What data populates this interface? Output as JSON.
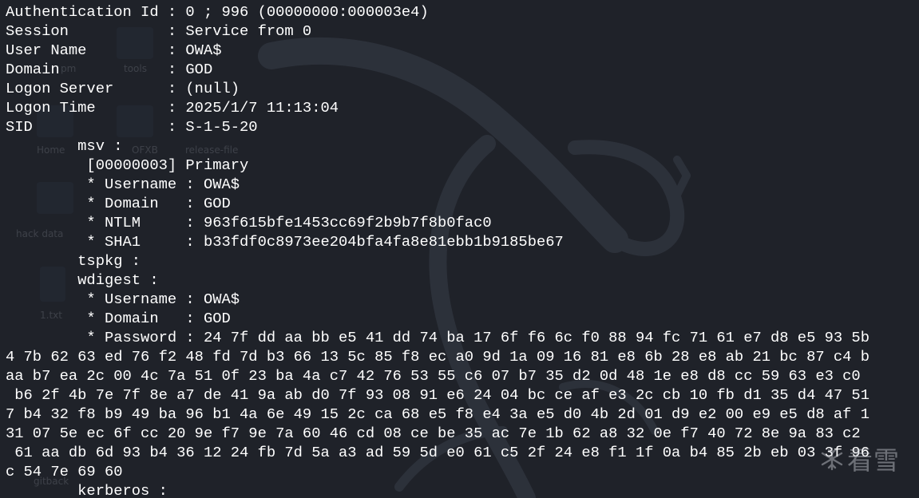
{
  "terminal": {
    "lines": [
      "Authentication Id : 0 ; 996 (00000000:000003e4)",
      "Session           : Service from 0",
      "User Name         : OWA$",
      "Domain            : GOD",
      "Logon Server      : (null)",
      "Logon Time        : 2025/1/7 11:13:04",
      "SID               : S-1-5-20",
      "        msv :",
      "         [00000003] Primary",
      "         * Username : OWA$",
      "         * Domain   : GOD",
      "         * NTLM     : 963f615bfe1453cc69f2b9b7f8b0fac0",
      "         * SHA1     : b33fdf0c8973ee204bfa4fa8e81ebb1b9185be67",
      "        tspkg :",
      "        wdigest :",
      "         * Username : OWA$",
      "         * Domain   : GOD",
      "         * Password : 24 7f dd aa bb e5 41 dd 74 ba 17 6f f6 6c f0 88 94 fc 71 61 e7 d8 e5 93 5b",
      "4 7b 62 63 ed 76 f2 48 fd 7d b3 66 13 5c 85 f8 ec a0 9d 1a 09 16 81 e8 6b 28 e8 ab 21 bc 87 c4 b",
      "aa b7 ea 2c 00 4c 7a 51 0f 23 ba 4a c7 42 76 53 55 c6 07 b7 35 d2 0d 48 1e e8 d8 cc 59 63 e3 c0",
      " b6 2f 4b 7e 7f 8e a7 de 41 9a ab d0 7f 93 08 91 e6 24 04 bc ce af e3 2c cb 10 fb d1 35 d4 47 51",
      "7 b4 32 f8 b9 49 ba 96 b1 4a 6e 49 15 2c ca 68 e5 f8 e4 3a e5 d0 4b 2d 01 d9 e2 00 e9 e5 d8 af 1",
      "31 07 5e ec 6f cc 20 9e f7 9e 7a 60 46 cd 08 ce be 35 ac 7e 1b 62 a8 32 0e f7 40 72 8e 9a 83 c2",
      " 61 aa db 6d 93 b4 36 12 24 fb 7d 5a a3 ad 59 5d e0 61 c5 2f 24 e8 f1 1f 0a b4 85 2b eb 03 3f 96",
      "c 54 7e 69 60",
      "        kerberos :"
    ]
  },
  "desktop": {
    "labels": [
      "pm",
      "tools",
      "Home",
      "OFXB",
      "release-file",
      "hack data",
      "1.txt",
      "gitback"
    ]
  },
  "watermark": {
    "text": "看雪"
  },
  "colors": {
    "background": "#1f2229",
    "text": "#ffffff",
    "dragon": "#4a5260"
  }
}
